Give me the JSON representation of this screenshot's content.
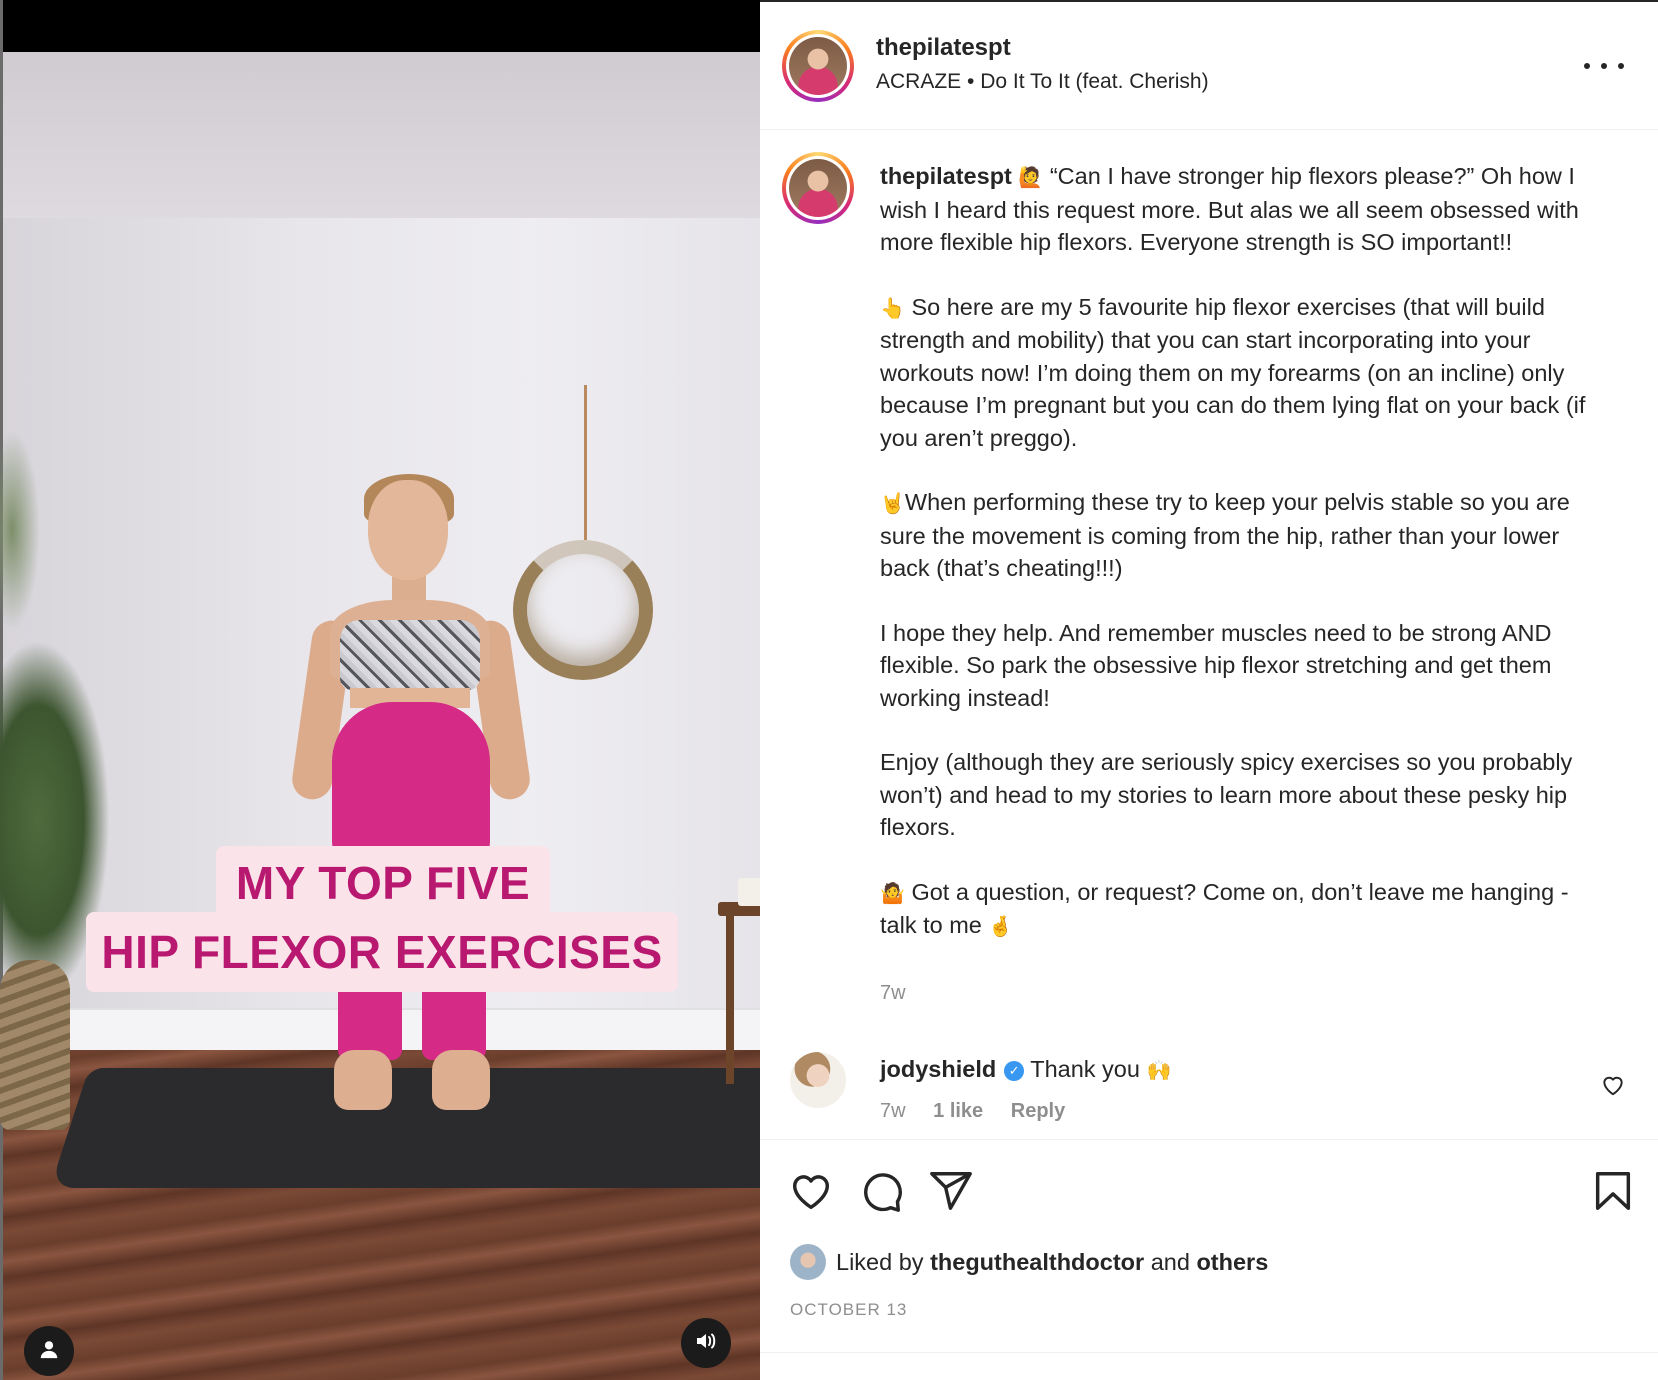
{
  "media": {
    "overlay_line1": "MY TOP FIVE",
    "overlay_line2": "HIP FLEXOR EXERCISES",
    "user_tag_icon": "person-icon",
    "audio_icon": "speaker-icon"
  },
  "post": {
    "username": "thepilatespt",
    "audio_artist": "ACRAZE",
    "audio_separator": "•",
    "audio_track": "Do It To It (feat. Cherish)",
    "more_icon": "more-horizontal-icon"
  },
  "caption": {
    "username": "thepilatespt",
    "emoji_1": "🙋",
    "p1": "“Can I have stronger hip flexors please?” Oh how I wish I heard this request more. But alas we all seem obsessed with more flexible hip flexors. Everyone strength is SO important!!",
    "emoji_2": "👆",
    "p2": "So here are my 5 favourite hip flexor exercises (that will build strength and mobility) that you can start incorporating into your workouts now! I’m doing them on my forearms (on an incline) only because I’m pregnant but you can do them lying flat on your back (if you aren’t preggo).",
    "emoji_3": "🤘",
    "p3": "When performing these try to keep your pelvis stable so you are sure the movement is coming from the hip, rather than your lower back (that’s cheating!!!)",
    "p4": "I hope they help. And remember muscles need to be strong AND flexible. So park the obsessive hip flexor stretching and get them working instead!",
    "p5": "Enjoy (although they are seriously spicy exercises so you probably won’t) and head to my stories to learn more about these pesky hip flexors.",
    "emoji_4": "🤷",
    "p6": "Got a question, or request? Come on, don’t leave me hanging - talk to me",
    "emoji_5": "🤞",
    "time": "7w"
  },
  "comment": {
    "username": "jodyshield",
    "verified_icon": "verified-badge-icon",
    "text": "Thank you",
    "emoji": "🙌",
    "time": "7w",
    "likes": "1 like",
    "reply": "Reply",
    "like_icon": "heart-icon"
  },
  "actions": {
    "like_icon": "heart-icon",
    "comment_icon": "comment-icon",
    "share_icon": "share-icon",
    "save_icon": "bookmark-icon",
    "liked_prefix": "Liked by",
    "liked_user": "theguthealthdoctor",
    "liked_and": "and",
    "liked_others": "others",
    "date": "OCTOBER 13"
  }
}
